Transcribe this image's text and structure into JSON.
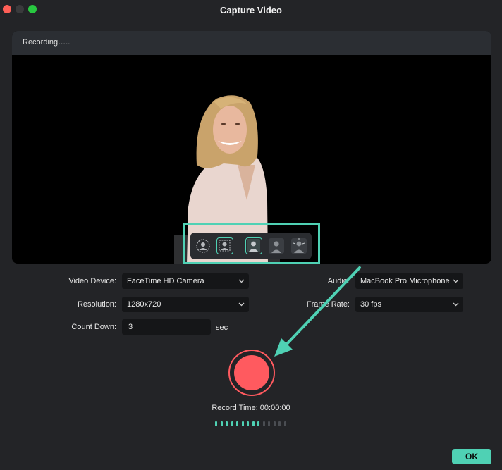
{
  "window": {
    "title": "Capture Video"
  },
  "preview": {
    "status": "Recording….."
  },
  "blur_toolbar": {
    "buttons": [
      {
        "icon": "portrait-circle-icon",
        "selected": false
      },
      {
        "icon": "portrait-blur-icon",
        "selected": true
      },
      {
        "icon": "person-solid-icon",
        "selected": true
      },
      {
        "icon": "person-dark-icon",
        "selected": false
      },
      {
        "icon": "person-sparkle-icon",
        "selected": false
      }
    ]
  },
  "settings": {
    "video_device": {
      "label": "Video Device:",
      "value": "FaceTime HD Camera"
    },
    "resolution": {
      "label": "Resolution:",
      "value": "1280x720"
    },
    "count_down": {
      "label": "Count Down:",
      "value": "3",
      "unit": "sec"
    },
    "audio": {
      "label": "Audio:",
      "value": "MacBook Pro Microphone"
    },
    "frame_rate": {
      "label": "Frame Rate:",
      "value": "30 fps"
    }
  },
  "recording": {
    "time_label": "Record Time: 00:00:00",
    "level_bars_total": 14,
    "level_bars_active": 9
  },
  "ok_button": {
    "label": "OK"
  },
  "colors": {
    "accent": "#4fd1b4",
    "record": "#ff5a5f",
    "background": "#232427"
  }
}
